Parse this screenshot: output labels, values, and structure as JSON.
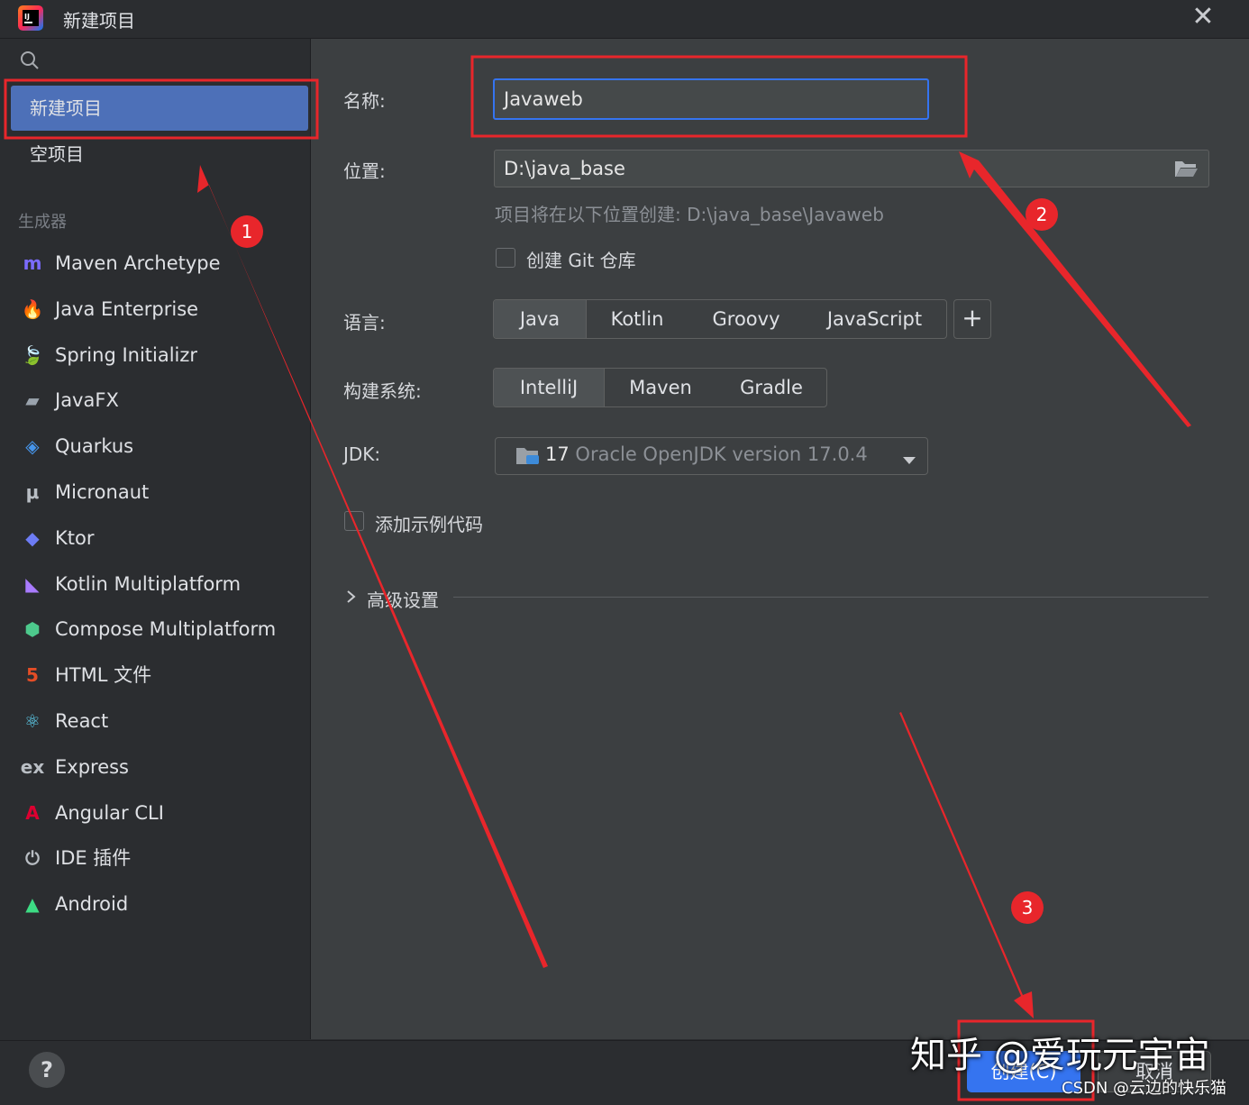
{
  "window": {
    "title": "新建项目",
    "close_glyph": "✕"
  },
  "sidebar": {
    "items": [
      {
        "label": "新建项目",
        "selected": true
      },
      {
        "label": "空项目",
        "selected": false
      }
    ],
    "generators_label": "生成器",
    "generators": [
      {
        "label": "Maven Archetype",
        "icon": "maven-icon",
        "glyph": "m"
      },
      {
        "label": "Java Enterprise",
        "icon": "java-enterprise-icon",
        "glyph": "🔥"
      },
      {
        "label": "Spring Initializr",
        "icon": "spring-icon",
        "glyph": "🍃"
      },
      {
        "label": "JavaFX",
        "icon": "javafx-folder-icon",
        "glyph": "▰"
      },
      {
        "label": "Quarkus",
        "icon": "quarkus-icon",
        "glyph": "◈"
      },
      {
        "label": "Micronaut",
        "icon": "micronaut-icon",
        "glyph": "μ"
      },
      {
        "label": "Ktor",
        "icon": "ktor-icon",
        "glyph": "◆"
      },
      {
        "label": "Kotlin Multiplatform",
        "icon": "kotlin-icon",
        "glyph": "◣"
      },
      {
        "label": "Compose Multiplatform",
        "icon": "compose-icon",
        "glyph": "⬢"
      },
      {
        "label": "HTML 文件",
        "icon": "html5-icon",
        "glyph": "5"
      },
      {
        "label": "React",
        "icon": "react-icon",
        "glyph": "⚛"
      },
      {
        "label": "Express",
        "icon": "express-icon",
        "glyph": "ex"
      },
      {
        "label": "Angular CLI",
        "icon": "angular-icon",
        "glyph": "A"
      },
      {
        "label": "IDE 插件",
        "icon": "plugin-icon",
        "glyph": "⏻"
      },
      {
        "label": "Android",
        "icon": "android-icon",
        "glyph": "▲"
      }
    ]
  },
  "form": {
    "name_label": "名称:",
    "name_value": "Javaweb",
    "location_label": "位置:",
    "location_value": "D:\\java_base",
    "location_hint": "项目将在以下位置创建: D:\\java_base\\Javaweb",
    "git_label": "创建 Git 仓库",
    "language_label": "语言:",
    "languages": [
      "Java",
      "Kotlin",
      "Groovy",
      "JavaScript"
    ],
    "language_add": "+",
    "build_label": "构建系统:",
    "build_systems": [
      "IntelliJ",
      "Maven",
      "Gradle"
    ],
    "jdk_label": "JDK:",
    "jdk_version": "17",
    "jdk_name": "Oracle OpenJDK version 17.0.4",
    "sample_label": "添加示例代码",
    "advanced_label": "高级设置"
  },
  "footer": {
    "help": "?",
    "create": "创建(C)",
    "cancel": "取消"
  },
  "annotations": [
    "1",
    "2",
    "3"
  ],
  "watermarks": {
    "zhihu": "知乎 @爱玩元宇宙",
    "csdn": "CSDN @云边的快乐猫"
  },
  "colors": {
    "accent": "#3574f0",
    "selection": "#4d70b8",
    "annotation_red": "#e8262b"
  }
}
